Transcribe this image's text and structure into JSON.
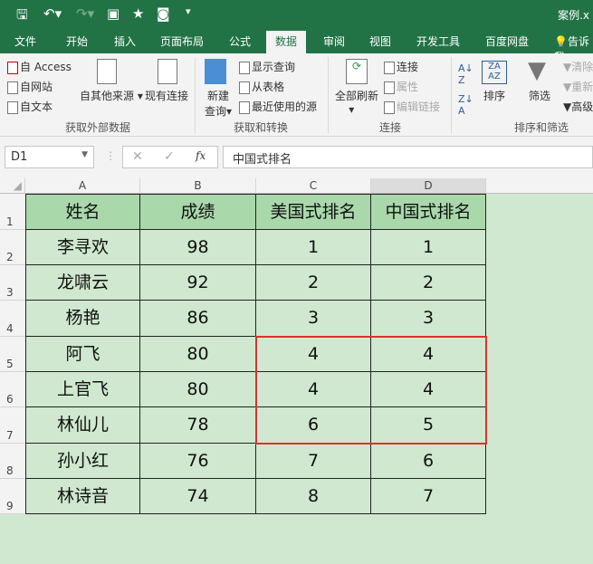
{
  "title": "案例.x",
  "quick_access": [
    "save-icon",
    "undo-icon",
    "redo-icon",
    "form-icon",
    "star-icon",
    "camera-icon",
    "customize-icon"
  ],
  "tabs": [
    "文件",
    "开始",
    "插入",
    "页面布局",
    "公式",
    "数据",
    "审阅",
    "视图",
    "开发工具",
    "百度网盘",
    "告诉我"
  ],
  "active_tab": "数据",
  "ribbon": {
    "get_external": {
      "label": "获取外部数据",
      "access": "自 Access",
      "web": "自网站",
      "text": "自文本",
      "other": "自其他来源",
      "existing": "现有连接"
    },
    "transform": {
      "label": "获取和转换",
      "new_query": "新建",
      "new_query2": "查询",
      "show": "显示查询",
      "from_table": "从表格",
      "recent": "最近使用的源"
    },
    "connections": {
      "label": "连接",
      "refresh": "全部刷新",
      "conn": "连接",
      "props": "属性",
      "edit": "编辑链接"
    },
    "sort_filter": {
      "label": "排序和筛选",
      "sort": "排序",
      "filter": "筛选",
      "clear": "清除",
      "reapply": "重新",
      "advanced": "高级"
    }
  },
  "formula_bar": {
    "name_box": "D1",
    "cancel": "✕",
    "enter": "✓",
    "fx": "fx",
    "value": "中国式排名"
  },
  "columns": [
    "A",
    "B",
    "C",
    "D"
  ],
  "rows": [
    "1",
    "2",
    "3",
    "4",
    "5",
    "6",
    "7",
    "8",
    "9"
  ],
  "table": {
    "headers": [
      "姓名",
      "成绩",
      "美国式排名",
      "中国式排名"
    ],
    "data": [
      [
        "李寻欢",
        "98",
        "1",
        "1"
      ],
      [
        "龙啸云",
        "92",
        "2",
        "2"
      ],
      [
        "杨艳",
        "86",
        "3",
        "3"
      ],
      [
        "阿飞",
        "80",
        "4",
        "4"
      ],
      [
        "上官飞",
        "80",
        "4",
        "4"
      ],
      [
        "林仙儿",
        "78",
        "6",
        "5"
      ],
      [
        "孙小红",
        "76",
        "7",
        "6"
      ],
      [
        "林诗音",
        "74",
        "8",
        "7"
      ]
    ]
  },
  "highlight_color": "#e0302c"
}
